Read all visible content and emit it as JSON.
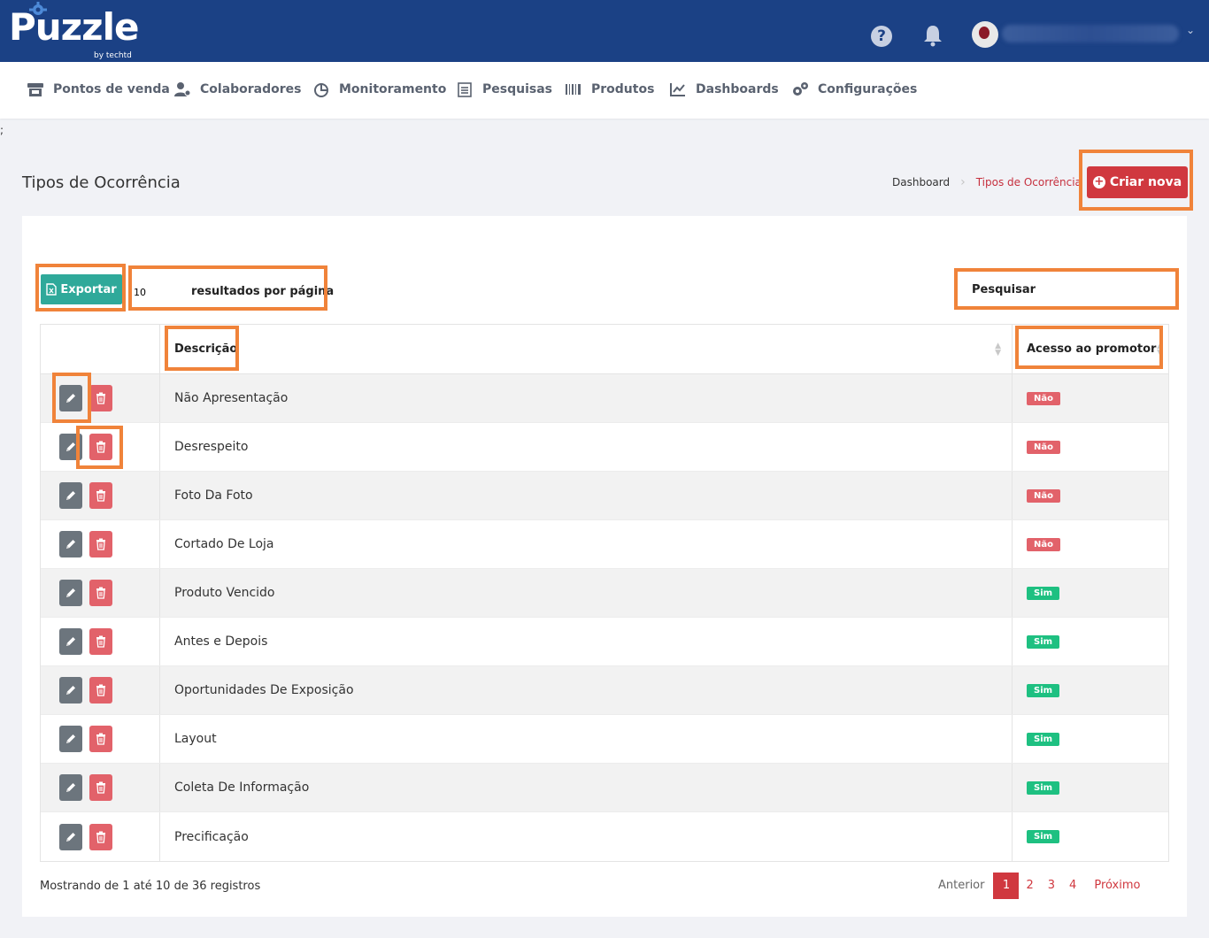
{
  "brand": {
    "name": "Puzzle",
    "sub": "by techtd"
  },
  "topbar": {
    "help_icon": "question-circle-icon",
    "bell_icon": "bell-icon"
  },
  "nav": [
    {
      "label": "Pontos de venda",
      "icon": "store-icon"
    },
    {
      "label": "Colaboradores",
      "icon": "users-cog-icon"
    },
    {
      "label": "Monitoramento",
      "icon": "chart-pie-icon"
    },
    {
      "label": "Pesquisas",
      "icon": "clipboard-list-icon"
    },
    {
      "label": "Produtos",
      "icon": "barcode-icon"
    },
    {
      "label": "Dashboards",
      "icon": "chart-line-icon"
    },
    {
      "label": "Configurações",
      "icon": "cogs-icon"
    }
  ],
  "stray_text": ";",
  "page": {
    "title": "Tipos de Ocorrência",
    "breadcrumb": {
      "home": "Dashboard",
      "current": "Tipos de Ocorrência"
    },
    "create_label": "Criar nova"
  },
  "toolbar": {
    "export_label": "Exportar",
    "per_page_value": "10",
    "per_page_label": "resultados por página",
    "search_label": "Pesquisar"
  },
  "table": {
    "headers": {
      "description": "Descrição",
      "access": "Acesso ao promotor"
    },
    "rows": [
      {
        "description": "Não Apresentação",
        "access": "Não"
      },
      {
        "description": "Desrespeito",
        "access": "Não"
      },
      {
        "description": "Foto Da Foto",
        "access": "Não"
      },
      {
        "description": "Cortado De Loja",
        "access": "Não"
      },
      {
        "description": "Produto Vencido",
        "access": "Sim"
      },
      {
        "description": "Antes e Depois",
        "access": "Sim"
      },
      {
        "description": "Oportunidades De Exposição",
        "access": "Sim"
      },
      {
        "description": "Layout",
        "access": "Sim"
      },
      {
        "description": "Coleta De Informação",
        "access": "Sim"
      },
      {
        "description": "Precificação",
        "access": "Sim"
      }
    ]
  },
  "footer": {
    "info": "Mostrando de 1 até 10 de 36 registros",
    "prev": "Anterior",
    "pages": [
      "1",
      "2",
      "3",
      "4"
    ],
    "active_page": "1",
    "next": "Próximo"
  },
  "colors": {
    "topbar": "#1b4185",
    "accent": "#d0383f",
    "export": "#2fa99a",
    "badge_no": "#e2626a",
    "badge_yes": "#1ec081",
    "highlight": "#f0833a"
  }
}
